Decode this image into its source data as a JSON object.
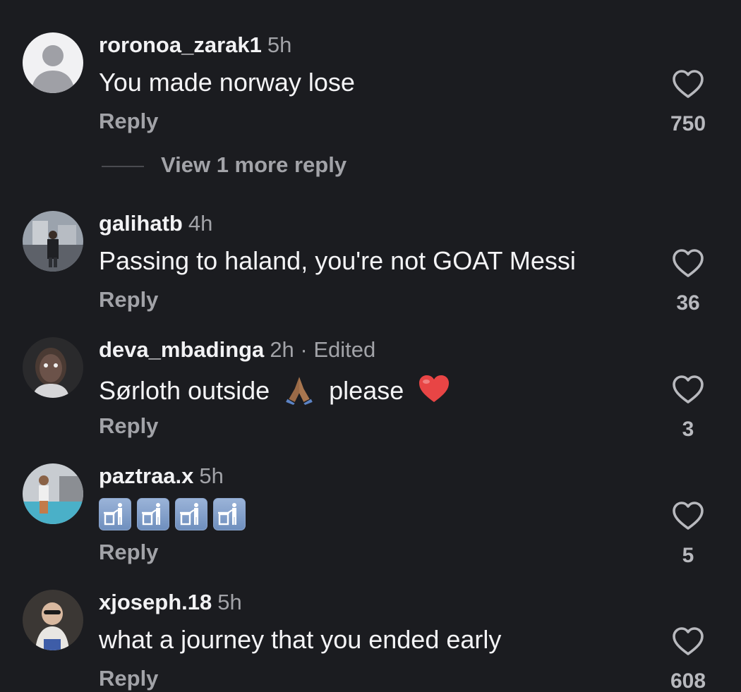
{
  "comments": [
    {
      "username": "roronoa_zarak1",
      "time": "5h",
      "edited": "",
      "text": "You made norway lose",
      "reply_label": "Reply",
      "likes": "750",
      "view_more": "View 1 more reply",
      "avatar": "default-avatar-icon"
    },
    {
      "username": "galihatb",
      "time": "4h",
      "edited": "",
      "text": "Passing to haland, you're not GOAT Messi",
      "reply_label": "Reply",
      "likes": "36",
      "avatar": "profile-photo"
    },
    {
      "username": "deva_mbadinga",
      "time": "2h",
      "edited": "· Edited",
      "text_parts": [
        "Sørloth  outside",
        "please"
      ],
      "emojis": [
        "folded-hands-emoji",
        "red-heart-emoji"
      ],
      "reply_label": "Reply",
      "likes": "3",
      "avatar": "profile-photo"
    },
    {
      "username": "paztraa.x",
      "time": "5h",
      "edited": "",
      "emojis": [
        "litter-in-bin-sign-emoji",
        "litter-in-bin-sign-emoji",
        "litter-in-bin-sign-emoji",
        "litter-in-bin-sign-emoji"
      ],
      "reply_label": "Reply",
      "likes": "5",
      "avatar": "profile-photo"
    },
    {
      "username": "xjoseph.18",
      "time": "5h",
      "edited": "",
      "text": "what a journey that you ended early",
      "reply_label": "Reply",
      "likes": "608",
      "avatar": "profile-photo"
    }
  ],
  "colors": {
    "background": "#1b1c20",
    "text": "#f2f2f4",
    "secondary": "#a2a3a8",
    "heart": "#e84545"
  }
}
